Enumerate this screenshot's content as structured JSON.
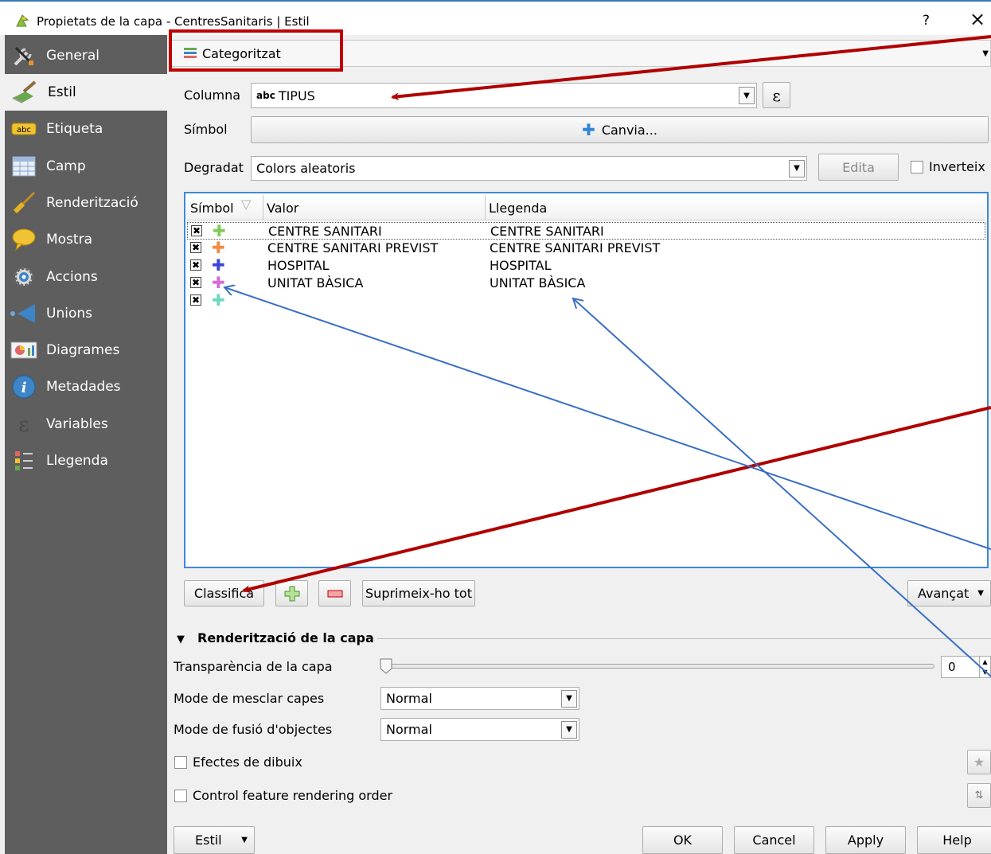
{
  "window": {
    "title": "Propietats de la capa - CentresSanitaris | Estil",
    "help_label": "?",
    "close_label": "×"
  },
  "sidebar": {
    "items": [
      {
        "label": "General",
        "icon": "tools-icon"
      },
      {
        "label": "Estil",
        "icon": "paintbrush-icon"
      },
      {
        "label": "Etiqueta",
        "icon": "label-abc-icon"
      },
      {
        "label": "Camp",
        "icon": "table-icon"
      },
      {
        "label": "Renderització",
        "icon": "brush-icon"
      },
      {
        "label": "Mostra",
        "icon": "speech-bubble-icon"
      },
      {
        "label": "Accions",
        "icon": "gear-icon"
      },
      {
        "label": "Unions",
        "icon": "join-icon"
      },
      {
        "label": "Diagrames",
        "icon": "chart-icon"
      },
      {
        "label": "Metadades",
        "icon": "info-icon"
      },
      {
        "label": "Variables",
        "icon": "epsilon-icon"
      },
      {
        "label": "Llegenda",
        "icon": "legend-icon"
      }
    ]
  },
  "renderer": {
    "value": "Categoritzat"
  },
  "column": {
    "label": "Columna",
    "type_prefix": "abc",
    "value": "TIPUS",
    "expr_label": "ε"
  },
  "symbol": {
    "label": "Símbol",
    "button_label": "Canvia..."
  },
  "ramp": {
    "label": "Degradat",
    "value": "Colors aleatoris",
    "edit_label": "Edita",
    "invert_label": "Inverteix"
  },
  "table": {
    "headers": [
      "Símbol",
      "Valor",
      "Llegenda"
    ],
    "rows": [
      {
        "value": "CENTRE SANITARI",
        "legend": "CENTRE SANITARI",
        "color": "#7fcc5a"
      },
      {
        "value": "CENTRE SANITARI PREVIST",
        "legend": "CENTRE SANITARI PREVIST",
        "color": "#f08b3e"
      },
      {
        "value": "HOSPITAL",
        "legend": "HOSPITAL",
        "color": "#3e45d6"
      },
      {
        "value": "UNITAT BÀSICA",
        "legend": "UNITAT BÀSICA",
        "color": "#d66bd6"
      },
      {
        "value": "",
        "legend": "",
        "color": "#6fd6c2"
      }
    ]
  },
  "actions": {
    "classify": "Classifica",
    "delete_all": "Suprimeix-ho tot",
    "advanced": "Avançat"
  },
  "layer_render": {
    "section_title": "Renderització de la capa",
    "transparency_label": "Transparència de la capa",
    "transparency_value": "0",
    "blend_label": "Mode de mesclar capes",
    "blend_value": "Normal",
    "feature_blend_label": "Mode de fusió d'objectes",
    "feature_blend_value": "Normal",
    "effects_label": "Efectes de dibuix",
    "order_label": "Control feature rendering order"
  },
  "footer": {
    "style": "Estil",
    "ok": "OK",
    "cancel": "Cancel",
    "apply": "Apply",
    "help": "Help"
  },
  "colors": {
    "sidebar": "#5e5e5e",
    "annotation_red": "#b00000",
    "annotation_blue": "#3a6fc4",
    "table_border": "#3c8ad8"
  }
}
